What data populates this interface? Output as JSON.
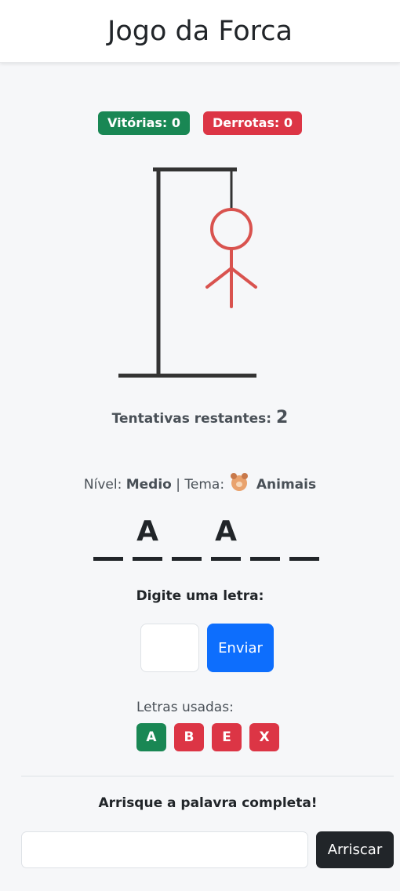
{
  "header": {
    "title": "Jogo da Forca"
  },
  "stats": {
    "wins": "Vitórias: 0",
    "losses": "Derrotas: 0"
  },
  "attempts": {
    "label": "Tentativas restantes:",
    "value": "2"
  },
  "info": {
    "level_label": "Nível:",
    "level_value": "Medio",
    "separator": "|",
    "theme_label": "Tema:",
    "theme_icon": "bear-face-icon",
    "theme_value": "Animais"
  },
  "word": {
    "slots": [
      "",
      "A",
      "",
      "A",
      "",
      ""
    ]
  },
  "letter_form": {
    "prompt": "Digite uma letra:",
    "input_value": "",
    "submit_label": "Enviar"
  },
  "used_letters": {
    "label": "Letras usadas:",
    "items": [
      {
        "letter": "A",
        "status": "correct"
      },
      {
        "letter": "B",
        "status": "wrong"
      },
      {
        "letter": "E",
        "status": "wrong"
      },
      {
        "letter": "X",
        "status": "wrong"
      }
    ]
  },
  "guess_form": {
    "title": "Arrisque a palavra completa!",
    "input_value": "",
    "submit_label": "Arriscar"
  },
  "colors": {
    "success": "#198754",
    "danger": "#dc3545",
    "primary": "#0d6efd",
    "dark": "#212529",
    "figure": "#d9534f"
  }
}
